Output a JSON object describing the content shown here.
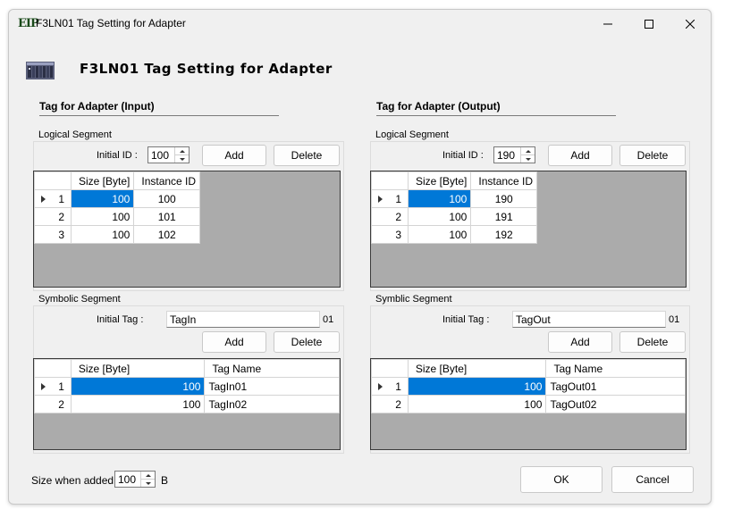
{
  "window": {
    "icon_text": "EIP",
    "title": "F3LN01 Tag Setting for Adapter",
    "minimize": "minimize",
    "maximize": "maximize",
    "close": "close"
  },
  "header": {
    "title": "F3LN01 Tag Setting for Adapter"
  },
  "input": {
    "section_title": "Tag for Adapter (Input)",
    "logical": {
      "group_label": "Logical Segment",
      "initial_id_label": "Initial ID :",
      "initial_id_value": "100",
      "add": "Add",
      "delete": "Delete",
      "columns": [
        "Size [Byte]",
        "Instance ID"
      ],
      "rows": [
        {
          "index": "1",
          "size": "100",
          "id": "100"
        },
        {
          "index": "2",
          "size": "100",
          "id": "101"
        },
        {
          "index": "3",
          "size": "100",
          "id": "102"
        }
      ]
    },
    "symbolic": {
      "group_label": "Symbolic Segment",
      "initial_tag_label": "Initial Tag :",
      "initial_tag_value": "TagIn",
      "suffix": "01",
      "add": "Add",
      "delete": "Delete",
      "columns": [
        "Size [Byte]",
        "Tag Name"
      ],
      "rows": [
        {
          "index": "1",
          "size": "100",
          "name": "TagIn01"
        },
        {
          "index": "2",
          "size": "100",
          "name": "TagIn02"
        }
      ]
    }
  },
  "output": {
    "section_title": "Tag for Adapter (Output)",
    "logical": {
      "group_label": "Logical Segment",
      "initial_id_label": "Initial ID :",
      "initial_id_value": "190",
      "add": "Add",
      "delete": "Delete",
      "columns": [
        "Size [Byte]",
        "Instance ID"
      ],
      "rows": [
        {
          "index": "1",
          "size": "100",
          "id": "190"
        },
        {
          "index": "2",
          "size": "100",
          "id": "191"
        },
        {
          "index": "3",
          "size": "100",
          "id": "192"
        }
      ]
    },
    "symbolic": {
      "group_label": "Symblic Segment",
      "initial_tag_label": "Initial Tag :",
      "initial_tag_value": "TagOut",
      "suffix": "01",
      "add": "Add",
      "delete": "Delete",
      "columns": [
        "Size [Byte]",
        "Tag Name"
      ],
      "rows": [
        {
          "index": "1",
          "size": "100",
          "name": "TagOut01"
        },
        {
          "index": "2",
          "size": "100",
          "name": "TagOut02"
        }
      ]
    }
  },
  "footer": {
    "size_label": "Size when added :",
    "size_value": "100",
    "size_unit": "B",
    "ok": "OK",
    "cancel": "Cancel"
  },
  "colors": {
    "selection": "#0078d7",
    "grid_background": "#ababab",
    "window_background": "#f0f0f0"
  }
}
